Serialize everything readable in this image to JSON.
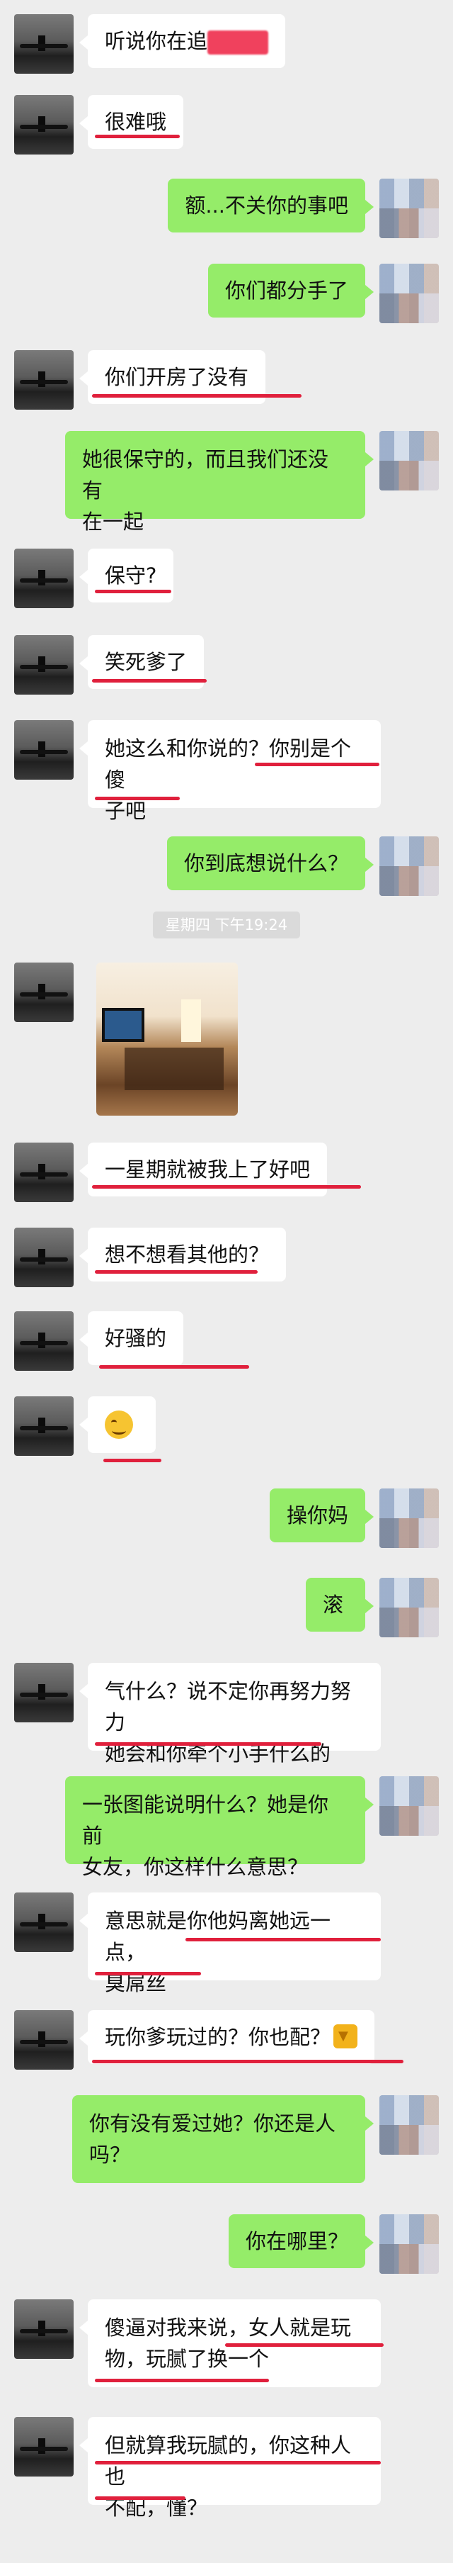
{
  "colors": {
    "background": "#ededed",
    "incoming_bubble": "#ffffff",
    "outgoing_bubble": "#95ec69",
    "underline": "#e0203c"
  },
  "timestamp": "星期四 下午19:24",
  "messages": [
    {
      "side": "left",
      "text": "听说你在追"
    },
    {
      "side": "left",
      "text": "很难哦"
    },
    {
      "side": "right",
      "text": "额...不关你的事吧"
    },
    {
      "side": "right",
      "text": "你们都分手了"
    },
    {
      "side": "left",
      "text": "你们开房了没有"
    },
    {
      "side": "right",
      "text": "她很保守的，而且我们还没有\n在一起"
    },
    {
      "side": "left",
      "text": "保守?"
    },
    {
      "side": "left",
      "text": "笑死爹了"
    },
    {
      "side": "left",
      "text": "她这么和你说的？你别是个傻\n子吧"
    },
    {
      "side": "right",
      "text": "你到底想说什么？"
    },
    {
      "side": "left",
      "type": "image"
    },
    {
      "side": "left",
      "text": "一星期就被我上了好吧"
    },
    {
      "side": "left",
      "text": "想不想看其他的？"
    },
    {
      "side": "left",
      "text": "好骚的"
    },
    {
      "side": "left",
      "type": "emoji",
      "icon": "smirk-emoji"
    },
    {
      "side": "right",
      "text": "操你妈"
    },
    {
      "side": "right",
      "text": "滚"
    },
    {
      "side": "left",
      "text": "气什么？说不定你再努力努力\n她会和你牵个小手什么的"
    },
    {
      "side": "right",
      "text": "一张图能说明什么？她是你前\n女友，你这样什么意思？"
    },
    {
      "side": "left",
      "text": "意思就是你他妈离她远一点，\n臭屌丝"
    },
    {
      "side": "left",
      "text": "玩你爹玩过的？你也配？",
      "icon": "thumbs-down-emoji"
    },
    {
      "side": "right",
      "text": "你有没有爱过她？你还是人\n吗？"
    },
    {
      "side": "right",
      "text": "你在哪里？"
    },
    {
      "side": "left",
      "text": "傻逼对我来说，女人就是玩\n物，玩腻了换一个"
    },
    {
      "side": "left",
      "text": "但就算我玩腻的，你这种人也\n不配，懂？"
    }
  ]
}
